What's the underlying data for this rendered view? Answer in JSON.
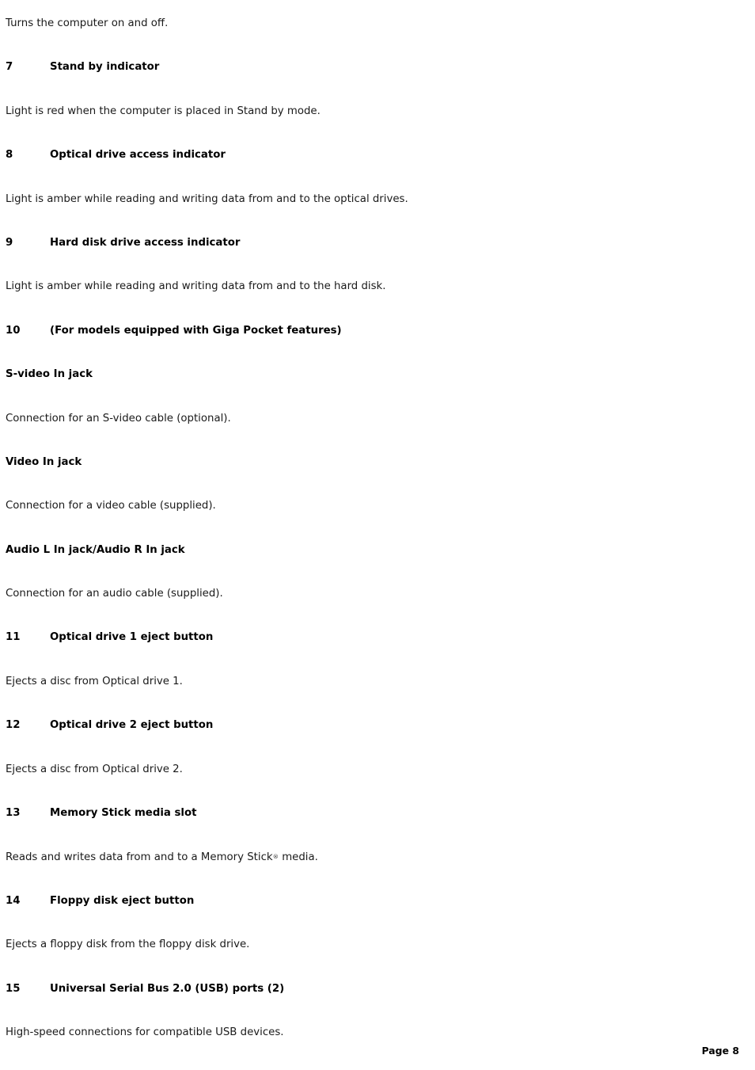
{
  "document": {
    "page_label": "Page 8",
    "blocks": [
      {
        "kind": "body",
        "text": "Turns the computer on and off."
      },
      {
        "kind": "numbered-heading",
        "number": "7",
        "label": "Stand by indicator"
      },
      {
        "kind": "body",
        "text": "Light is red when the computer is placed in Stand by mode."
      },
      {
        "kind": "numbered-heading",
        "number": "8",
        "label": "Optical drive access indicator"
      },
      {
        "kind": "body",
        "text": "Light is amber while reading and writing data from and to the optical drives."
      },
      {
        "kind": "numbered-heading",
        "number": "9",
        "label": "Hard disk drive access indicator"
      },
      {
        "kind": "body",
        "text": "Light is amber while reading and writing data from and to the hard disk."
      },
      {
        "kind": "numbered-heading",
        "number": "10",
        "label": "(For models equipped with Giga Pocket features)"
      },
      {
        "kind": "sub-heading",
        "text": "S-video In jack"
      },
      {
        "kind": "body",
        "text": "Connection for an S-video cable (optional)."
      },
      {
        "kind": "sub-heading",
        "text": "Video In jack"
      },
      {
        "kind": "body",
        "text": "Connection for a video cable (supplied)."
      },
      {
        "kind": "sub-heading",
        "text": "Audio L In jack/Audio R In jack"
      },
      {
        "kind": "body",
        "text": "Connection for an audio cable (supplied)."
      },
      {
        "kind": "numbered-heading",
        "number": "11",
        "label": "Optical drive 1 eject button"
      },
      {
        "kind": "body",
        "text": "Ejects a disc from Optical drive 1."
      },
      {
        "kind": "numbered-heading",
        "number": "12",
        "label": "Optical drive 2 eject button"
      },
      {
        "kind": "body",
        "text": "Ejects a disc from Optical drive 2."
      },
      {
        "kind": "numbered-heading",
        "number": "13",
        "label": "Memory Stick media slot"
      },
      {
        "kind": "body-registered",
        "text_before": "Reads and writes data from and to a Memory Stick",
        "symbol": "®",
        "text_after": " media."
      },
      {
        "kind": "numbered-heading",
        "number": "14",
        "label": "Floppy disk eject button"
      },
      {
        "kind": "body",
        "text": "Ejects a floppy disk from the floppy disk drive."
      },
      {
        "kind": "numbered-heading",
        "number": "15",
        "label": "Universal Serial Bus 2.0 (USB) ports (2)"
      },
      {
        "kind": "body",
        "text": "High-speed connections for compatible USB devices."
      }
    ]
  }
}
